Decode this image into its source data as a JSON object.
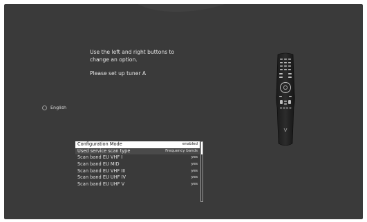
{
  "help": {
    "line1": "Use the left and right buttons to",
    "line2": "change an option.",
    "line3": "Please set up tuner A"
  },
  "language": {
    "label": "English"
  },
  "menu": {
    "items": [
      {
        "label": "Configuration Mode",
        "value": "enabled"
      },
      {
        "label": "Used service scan type",
        "value": "Frequency bands"
      },
      {
        "label": "Scan band EU VHF I",
        "value": "yes"
      },
      {
        "label": "Scan band EU MID",
        "value": "yes"
      },
      {
        "label": "Scan band EU VHF III",
        "value": "yes"
      },
      {
        "label": "Scan band EU UHF IV",
        "value": "yes"
      },
      {
        "label": "Scan band EU UHF V",
        "value": "yes"
      }
    ]
  },
  "remote": {
    "brand_logo": "V"
  }
}
